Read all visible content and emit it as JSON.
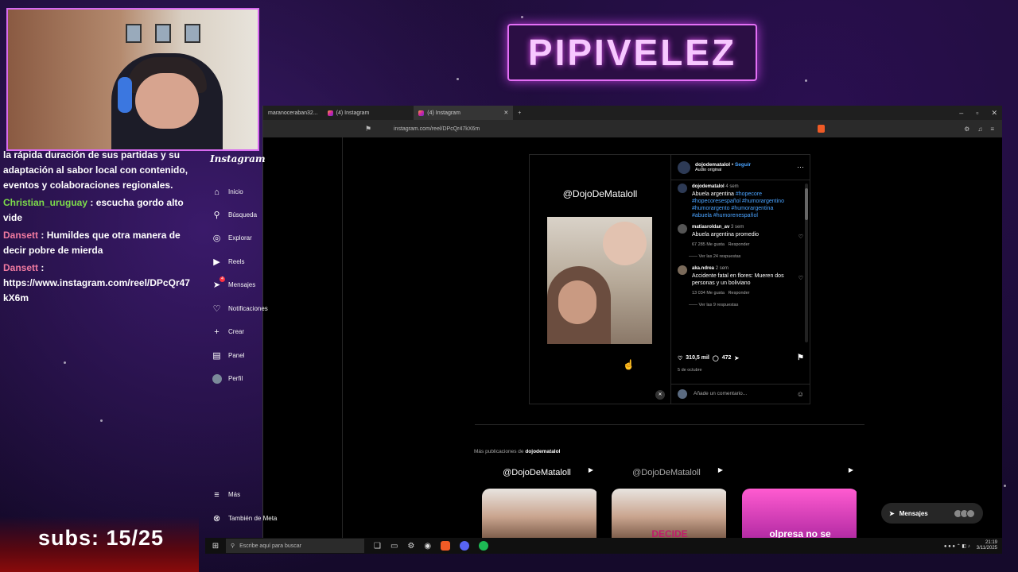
{
  "overlay": {
    "banner_text": "PIPIVELEZ",
    "subs_text": "subs: 15/25",
    "chat": [
      {
        "user": "",
        "text": "la rápida duración de sus partidas y su adaptación al sabor local con contenido, eventos y colaboraciones regionales."
      },
      {
        "user": "Christian_uruguay",
        "text": "escucha gordo alto vide"
      },
      {
        "user": "Dansett",
        "text": "Humildes que otra manera de decir pobre de mierda"
      },
      {
        "user": "Dansett",
        "text": "https://www.instagram.com/reel/DPcQr47kX6m"
      }
    ]
  },
  "browser": {
    "tabs": [
      {
        "label": "maranoceraban32..."
      },
      {
        "label": "(4) Instagram"
      },
      {
        "label": "(4) Instagram"
      }
    ],
    "new_tab_label": "+",
    "url": "instagram.com/reel/DPcQr47kX6m",
    "window_controls": [
      "–",
      "▫",
      "✕"
    ]
  },
  "instagram": {
    "logo": "Instagram",
    "nav": [
      {
        "label": "Inicio",
        "icon": "home-icon",
        "glyph": "⌂"
      },
      {
        "label": "Búsqueda",
        "icon": "search-icon",
        "glyph": "⚲"
      },
      {
        "label": "Explorar",
        "icon": "compass-icon",
        "glyph": "◎"
      },
      {
        "label": "Reels",
        "icon": "reels-icon",
        "glyph": "▶"
      },
      {
        "label": "Mensajes",
        "icon": "messages-icon",
        "glyph": "➤",
        "badge": "4"
      },
      {
        "label": "Notificaciones",
        "icon": "heart-icon",
        "glyph": "♡"
      },
      {
        "label": "Crear",
        "icon": "plus-icon",
        "glyph": "+"
      },
      {
        "label": "Panel",
        "icon": "dashboard-icon",
        "glyph": "▤"
      },
      {
        "label": "Perfil",
        "icon": "profile-avatar-icon",
        "glyph": ""
      }
    ],
    "nav_bottom": [
      {
        "label": "Más",
        "icon": "menu-icon",
        "glyph": "≡"
      },
      {
        "label": "También de Meta",
        "icon": "meta-icon",
        "glyph": "⊗"
      }
    ],
    "post": {
      "video_title": "@DojoDeMataloll",
      "author": "dojodematalol",
      "follow": "Seguir",
      "audio": "Audio original",
      "caption_user": "dojodematalol",
      "caption_time": "4 sem",
      "caption_text": "Abuela argentina",
      "caption_tags": "#hopecore #hopecoresespañol #humorargentino #humorargento #humorargentina #abuela #humorenespañol",
      "comments": [
        {
          "user": "matiasroldan_av",
          "time": "3 sem",
          "text": "Abuela argentina promedio",
          "likes": "67 285 Me gusta",
          "reply": "Responder",
          "replies": "Ver las 24 respuestas"
        },
        {
          "user": "aka.ndrea",
          "time": "2 sem",
          "text": "Accidente fatal en flores: Mueren dos personas y un boliviano",
          "likes": "13 034 Me gusta",
          "reply": "Responder",
          "replies": "Ver las 9 respuestas"
        }
      ],
      "likes_count": "310,5 mil",
      "comments_count": "472",
      "date": "5 de octubre",
      "add_comment_placeholder": "Añade un comentario..."
    },
    "more_posts_prefix": "Más publicaciones de",
    "more_posts_user": "dojodematalol",
    "grid": [
      {
        "title": "@DojoDeMataloll",
        "label": ""
      },
      {
        "title": "@DojoDeMataloll",
        "label": "DECIDE"
      },
      {
        "title": "",
        "label": "olpresa no se"
      }
    ],
    "messages_pill": "Mensajes"
  },
  "taskbar": {
    "search_placeholder": "Escribe aquí para buscar",
    "time": "21:19",
    "date": "3/11/2025"
  }
}
